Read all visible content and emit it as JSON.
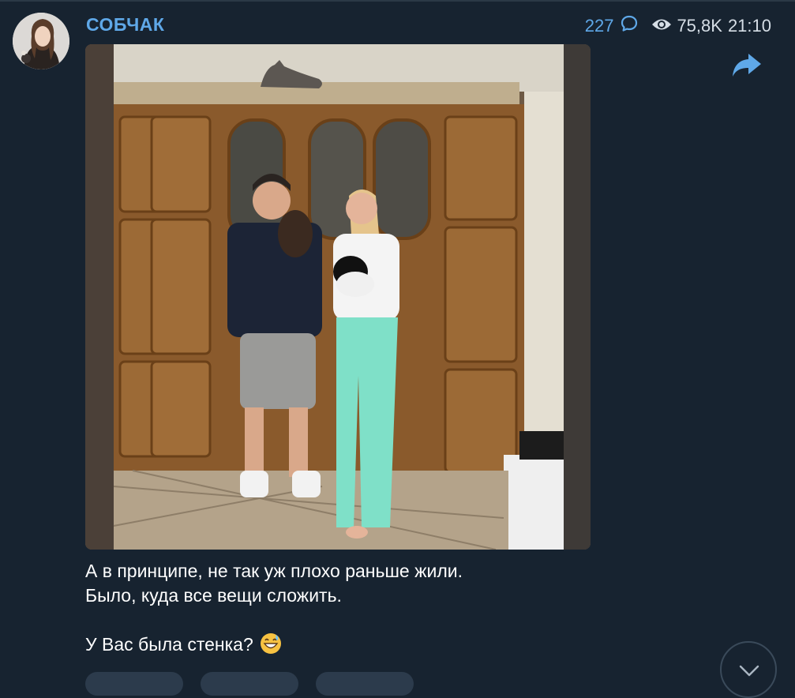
{
  "post": {
    "channel_name": "СОБЧАК",
    "comments_count": "227",
    "views": "75,8K",
    "time": "21:10",
    "caption_lines": [
      "А в принципе, не так уж плохо раньше жили.",
      "Было, куда все вещи сложить.",
      "",
      "У Вас была стенка?"
    ],
    "caption_emoji": "grinning-sweat-emoji"
  },
  "icons": {
    "comments": "comment-bubble-icon",
    "views": "eye-icon",
    "forward": "forward-arrow-icon",
    "scroll": "chevron-down-icon"
  },
  "colors": {
    "background": "#172330",
    "accent": "#5fa8e8",
    "meta_text": "#d6dee6",
    "caption_text": "#ffffff"
  }
}
